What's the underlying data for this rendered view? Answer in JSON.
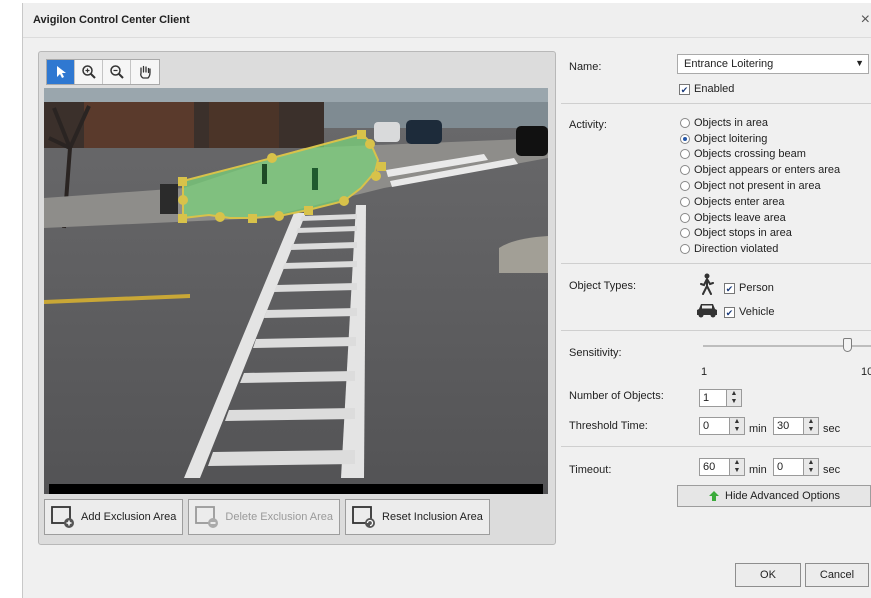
{
  "window": {
    "title": "Avigilon Control Center Client",
    "close_glyph": "×"
  },
  "toolbar": {
    "tools": [
      "pointer-icon",
      "zoom-in-icon",
      "zoom-out-icon",
      "pan-hand-icon"
    ],
    "active_color": "#2f78d1"
  },
  "video": {
    "zone_color": "#7bd27b",
    "handle_color": "#d8c24a"
  },
  "bottom_buttons": {
    "add_exclusion": "Add Exclusion Area",
    "delete_exclusion": "Delete Exclusion Area",
    "reset_inclusion": "Reset Inclusion Area"
  },
  "rule": {
    "name_label": "Name:",
    "name_value": "Entrance Loitering",
    "enabled_label": "Enabled",
    "enabled": true,
    "activity_label": "Activity:",
    "activities": [
      {
        "label": "Objects in area",
        "selected": false
      },
      {
        "label": "Object loitering",
        "selected": true
      },
      {
        "label": "Objects crossing beam",
        "selected": false
      },
      {
        "label": "Object appears or enters area",
        "selected": false
      },
      {
        "label": "Object not present in area",
        "selected": false
      },
      {
        "label": "Objects enter area",
        "selected": false
      },
      {
        "label": "Objects leave area",
        "selected": false
      },
      {
        "label": "Object stops in area",
        "selected": false
      },
      {
        "label": "Direction violated",
        "selected": false
      }
    ],
    "object_types_label": "Object Types:",
    "person_label": "Person",
    "vehicle_label": "Vehicle",
    "sensitivity_label": "Sensitivity:",
    "sensitivity_min": "1",
    "sensitivity_max": "10",
    "sensitivity_value": 8,
    "num_objects_label": "Number of Objects:",
    "num_objects": "1",
    "threshold_label": "Threshold Time:",
    "threshold_min": "0",
    "threshold_sec": "30",
    "timeout_label": "Timeout:",
    "timeout_min": "60",
    "timeout_sec": "0",
    "unit_min": "min",
    "unit_sec": "sec",
    "hide_advanced": "Hide Advanced Options"
  },
  "footer": {
    "ok": "OK",
    "cancel": "Cancel"
  }
}
